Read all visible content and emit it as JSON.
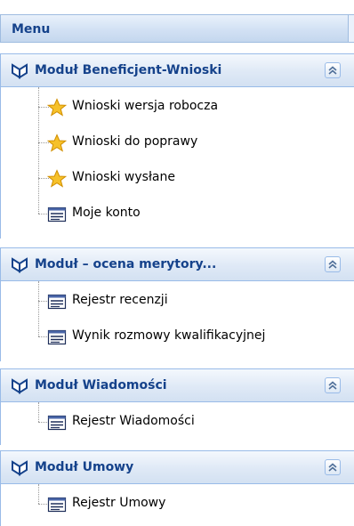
{
  "menu": {
    "title": "Menu"
  },
  "sections": [
    {
      "title": "Moduł Beneficjent-Wnioski",
      "items": [
        {
          "label": "Wnioski wersja robocza",
          "icon": "star-icon"
        },
        {
          "label": "Wnioski do poprawy",
          "icon": "star-icon"
        },
        {
          "label": "Wnioski wysłane",
          "icon": "star-icon"
        },
        {
          "label": "Moje konto",
          "icon": "list-icon"
        }
      ]
    },
    {
      "title": "Moduł – ocena merytory...",
      "items": [
        {
          "label": "Rejestr recenzji",
          "icon": "list-icon"
        },
        {
          "label": "Wynik rozmowy kwalifikacyjnej",
          "icon": "list-icon"
        }
      ]
    },
    {
      "title": "Moduł Wiadomości",
      "items": [
        {
          "label": "Rejestr Wiadomości",
          "icon": "list-icon"
        }
      ]
    },
    {
      "title": "Moduł Umowy",
      "items": [
        {
          "label": "Rejestr Umowy",
          "icon": "list-icon"
        }
      ]
    }
  ],
  "colors": {
    "header_text": "#15428b",
    "border": "#99bbe8",
    "star": "#f5b90f"
  }
}
